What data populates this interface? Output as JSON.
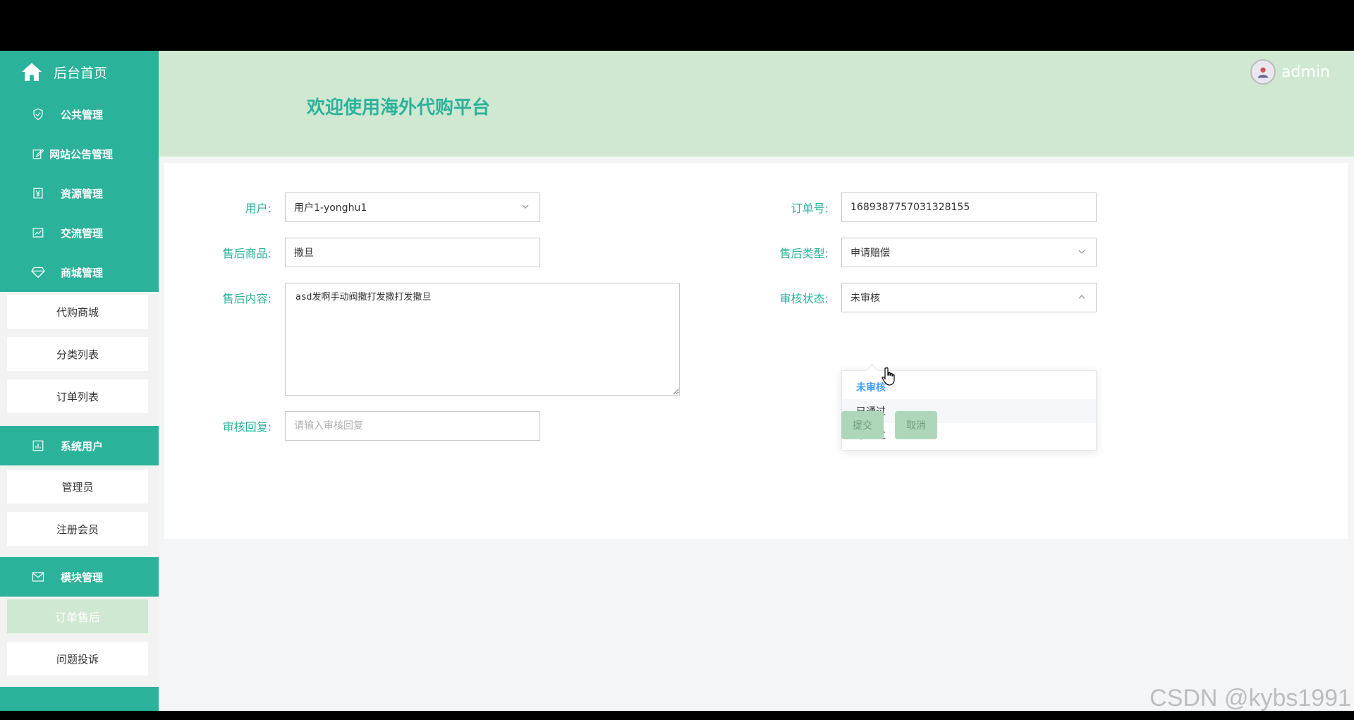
{
  "sidebar": {
    "home_label": "后台首页",
    "groups": [
      {
        "label": "公共管理",
        "icon": "shield-icon"
      },
      {
        "label": "网站公告管理",
        "icon": "edit-icon"
      },
      {
        "label": "资源管理",
        "icon": "yen-icon"
      },
      {
        "label": "交流管理",
        "icon": "chart-icon"
      },
      {
        "label": "商城管理",
        "icon": "diamond-icon"
      },
      {
        "label": "系统用户",
        "icon": "bar-chart-icon"
      },
      {
        "label": "模块管理",
        "icon": "mail-icon"
      }
    ],
    "mall_items": [
      "代购商城",
      "分类列表",
      "订单列表"
    ],
    "user_items": [
      "管理员",
      "注册会员"
    ],
    "module_items": [
      "订单售后",
      "问题投诉"
    ]
  },
  "header": {
    "title": "欢迎使用海外代购平台",
    "username": "admin"
  },
  "form": {
    "user_label": "用户:",
    "user_value": "用户1-yonghu1",
    "order_label": "订单号:",
    "order_value": "1689387757031328155",
    "product_label": "售后商品:",
    "product_value": "撒旦",
    "type_label": "售后类型:",
    "type_value": "申请赔偿",
    "content_label": "售后内容:",
    "content_value": "asd发啊手动阀撒打发撒打发撒旦",
    "status_label": "审核状态:",
    "status_value": "未审核",
    "reply_label": "审核回复:",
    "reply_placeholder": "请输入审核回复",
    "submit_label": "提交",
    "cancel_label": "取消"
  },
  "dropdown": {
    "options": [
      "未审核",
      "已通过",
      "未通过"
    ],
    "selected": "未审核",
    "hovered": "已通过"
  },
  "watermark": "CSDN @kybs1991",
  "colors": {
    "sidebar": "#2ab39a",
    "header": "#d0e8d2",
    "accent": "#2ab39a",
    "selected_option": "#409eff",
    "button": "#aed7ba"
  }
}
